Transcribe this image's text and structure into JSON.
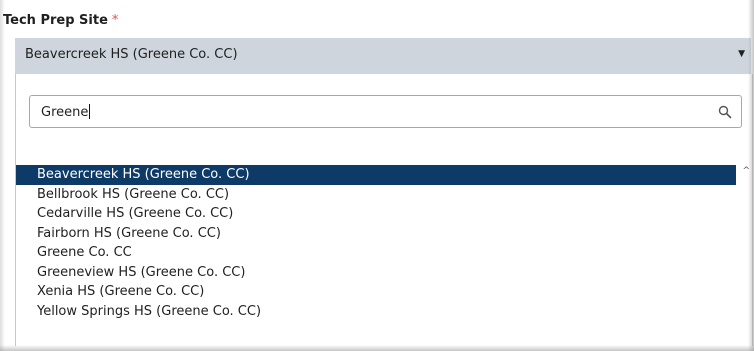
{
  "field": {
    "label": "Tech Prep Site",
    "required_marker": "*"
  },
  "select": {
    "value": "Beavercreek HS (Greene Co. CC)",
    "arrow": "▼"
  },
  "search": {
    "value": "Greene"
  },
  "results": [
    "Beavercreek HS (Greene Co. CC)",
    "Bellbrook HS (Greene Co. CC)",
    "Cedarville HS (Greene Co. CC)",
    "Fairborn HS (Greene Co. CC)",
    "Greene Co. CC",
    "Greeneview HS (Greene Co. CC)",
    "Xenia HS (Greene Co. CC)",
    "Yellow Springs HS (Greene Co. CC)"
  ],
  "selected_index": 0,
  "scrollbar": {
    "up_arrow": "^"
  },
  "colors": {
    "selected_bg": "#0d3a66",
    "select_bg": "#cfd5dc",
    "focus_border": "#7fb3d8",
    "required": "#d9534f"
  },
  "icons": {
    "search": "search-icon",
    "dropdown": "chevron-down-icon"
  }
}
